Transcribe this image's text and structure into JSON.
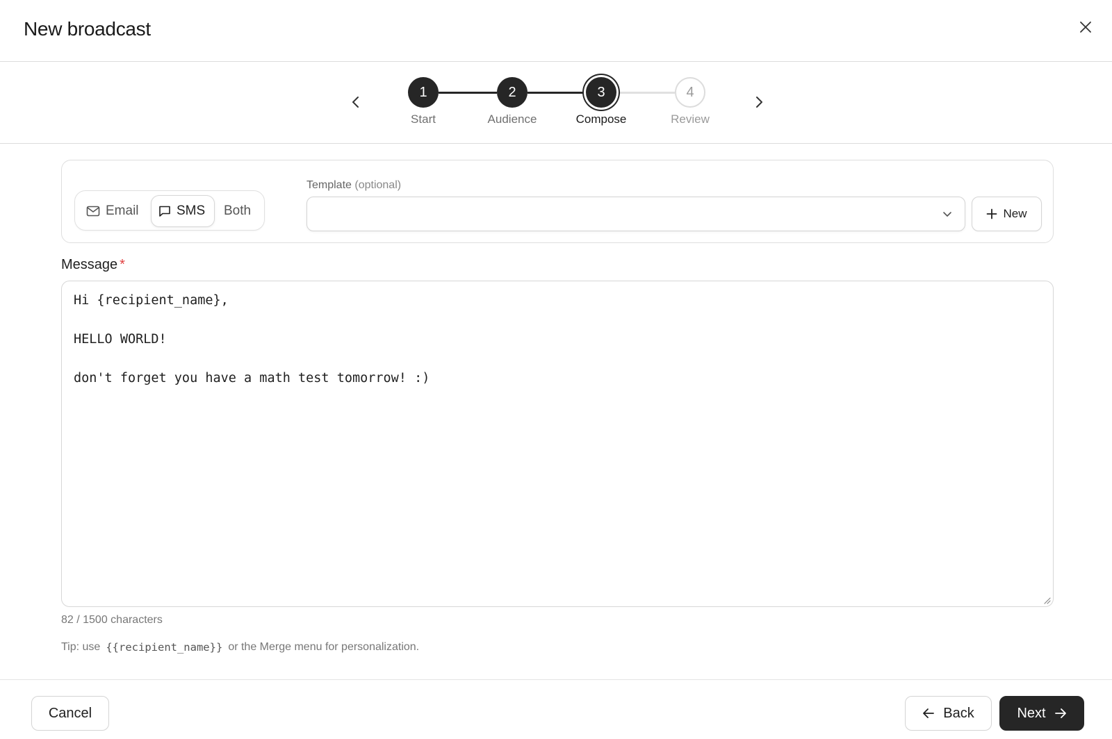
{
  "dialog": {
    "title": "New broadcast",
    "close_icon": "close-icon"
  },
  "stepper": {
    "steps": [
      {
        "number": "1",
        "label": "Start",
        "state": "complete"
      },
      {
        "number": "2",
        "label": "Audience",
        "state": "complete"
      },
      {
        "number": "3",
        "label": "Compose",
        "state": "active"
      },
      {
        "number": "4",
        "label": "Review",
        "state": "upcoming"
      }
    ],
    "prev_icon": "chevron-left-icon",
    "next_icon": "chevron-right-icon"
  },
  "channel": {
    "options": [
      {
        "label": "Email",
        "icon": "mail-icon",
        "selected": false
      },
      {
        "label": "SMS",
        "icon": "message-icon",
        "selected": true
      },
      {
        "label": "Both",
        "icon": "",
        "selected": false
      }
    ]
  },
  "template": {
    "label": "Template",
    "optional_text": "(optional)",
    "selected_value": "",
    "new_button_label": "New"
  },
  "message": {
    "label": "Message",
    "required_mark": "*",
    "value": "Hi {recipient_name},\n\nHELLO WORLD!\n\ndon't forget you have a math test tomorrow! :)",
    "char_count": "82 / 1500 characters",
    "tip_prefix": "Tip: use",
    "tip_code": "{{recipient_name}}",
    "tip_suffix": "or the Merge menu for personalization."
  },
  "footer": {
    "cancel_label": "Cancel",
    "back_label": "Back",
    "next_label": "Next"
  },
  "colors": {
    "primary_dark": "#262626",
    "border": "#d4d4d4",
    "required": "#e04040",
    "muted_text": "#777777"
  }
}
